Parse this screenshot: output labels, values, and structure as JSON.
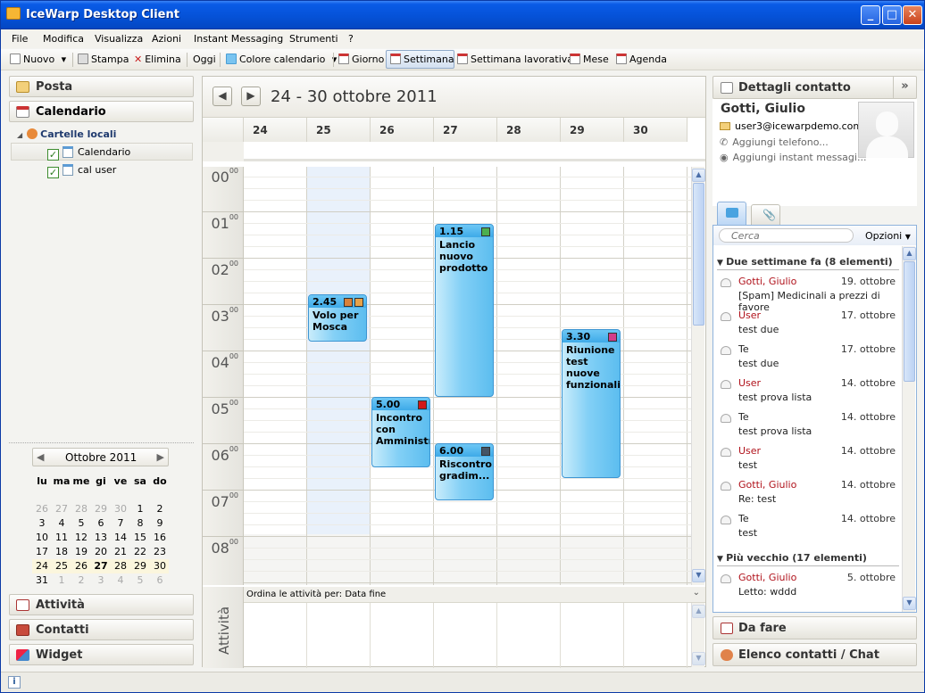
{
  "window": {
    "title": "IceWarp Desktop Client"
  },
  "menu": [
    "File",
    "Modifica",
    "Visualizza",
    "Azioni",
    "Instant Messaging",
    "Strumenti",
    "?"
  ],
  "toolbar": {
    "new": "Nuovo",
    "print": "Stampa",
    "delete": "Elimina",
    "today": "Oggi",
    "calendar_color": "Colore calendario",
    "day": "Giorno",
    "week": "Settimana",
    "work_week": "Settimana lavorativa",
    "month": "Mese",
    "agenda": "Agenda"
  },
  "left": {
    "mail": "Posta",
    "calendar": "Calendario",
    "local_folders": "Cartelle locali",
    "folders": [
      {
        "label": "Calendario",
        "checked": true
      },
      {
        "label": "cal user",
        "checked": true
      }
    ],
    "tasks": "Attività",
    "contacts": "Contatti",
    "widget": "Widget"
  },
  "minical": {
    "month": "Ottobre 2011",
    "weekdays": [
      "lu",
      "ma",
      "me",
      "gi",
      "ve",
      "sa",
      "do"
    ],
    "weeks": [
      [
        "26",
        "27",
        "28",
        "29",
        "30",
        "1",
        "2"
      ],
      [
        "3",
        "4",
        "5",
        "6",
        "7",
        "8",
        "9"
      ],
      [
        "10",
        "11",
        "12",
        "13",
        "14",
        "15",
        "16"
      ],
      [
        "17",
        "18",
        "19",
        "20",
        "21",
        "22",
        "23"
      ],
      [
        "24",
        "25",
        "26",
        "27",
        "28",
        "29",
        "30"
      ],
      [
        "31",
        "1",
        "2",
        "3",
        "4",
        "5",
        "6"
      ]
    ]
  },
  "calendar": {
    "range": "24 - 30 ottobre 2011",
    "days": [
      "24",
      "25",
      "26",
      "27",
      "28",
      "29",
      "30"
    ],
    "hours": [
      "00",
      "01",
      "02",
      "03",
      "04",
      "05",
      "06",
      "07",
      "08"
    ],
    "minutes": "00",
    "events": [
      {
        "time": "2.45",
        "title": "Volo per Mosca",
        "color": "#e6a24a",
        "color2": "#d9813a"
      },
      {
        "time": "1.15",
        "title": "Lancio nuovo prodotto",
        "color": "#4caf50"
      },
      {
        "time": "5.00",
        "title": "Incontro con Amministratore...",
        "color": "#d21818"
      },
      {
        "time": "6.00",
        "title": "Riscontro gradim...",
        "color": "#445566"
      },
      {
        "time": "3.30",
        "title": "Riunione test nuove funzionalità",
        "color": "#d23d8a"
      }
    ],
    "tasks_label": "Attività",
    "tasks_sort": "Ordina le attività per: Data fine"
  },
  "right": {
    "contact_header": "Dettagli contatto",
    "contact_name": "Gotti, Giulio",
    "email": "user3@icewarpdemo.com",
    "add_phone": "Aggiungi telefono...",
    "add_im": "Aggiungi instant messagi...",
    "search_placeholder": "Cerca",
    "options": "Opzioni",
    "group1": "Due settimane fa  (8 elementi)",
    "group2": "Più vecchio  (17 elementi)",
    "items": [
      {
        "from": "Gotti, Giulio",
        "date": "19. ottobre",
        "subject": "[Spam] Medicinali a prezzi di favore"
      },
      {
        "from": "User",
        "date": "17. ottobre",
        "subject": "test due"
      },
      {
        "from": "Te",
        "date": "17. ottobre",
        "subject": "test due"
      },
      {
        "from": "User",
        "date": "14. ottobre",
        "subject": "test prova lista"
      },
      {
        "from": "Te",
        "date": "14. ottobre",
        "subject": "test prova lista"
      },
      {
        "from": "User",
        "date": "14. ottobre",
        "subject": "test"
      },
      {
        "from": "Gotti, Giulio",
        "date": "14. ottobre",
        "subject": "Re: test"
      },
      {
        "from": "Te",
        "date": "14. ottobre",
        "subject": "test"
      }
    ],
    "older_items": [
      {
        "from": "Gotti, Giulio",
        "date": "5. ottobre",
        "subject": "Letto: wddd"
      }
    ],
    "todo": "Da fare",
    "contact_list": "Elenco contatti / Chat"
  }
}
